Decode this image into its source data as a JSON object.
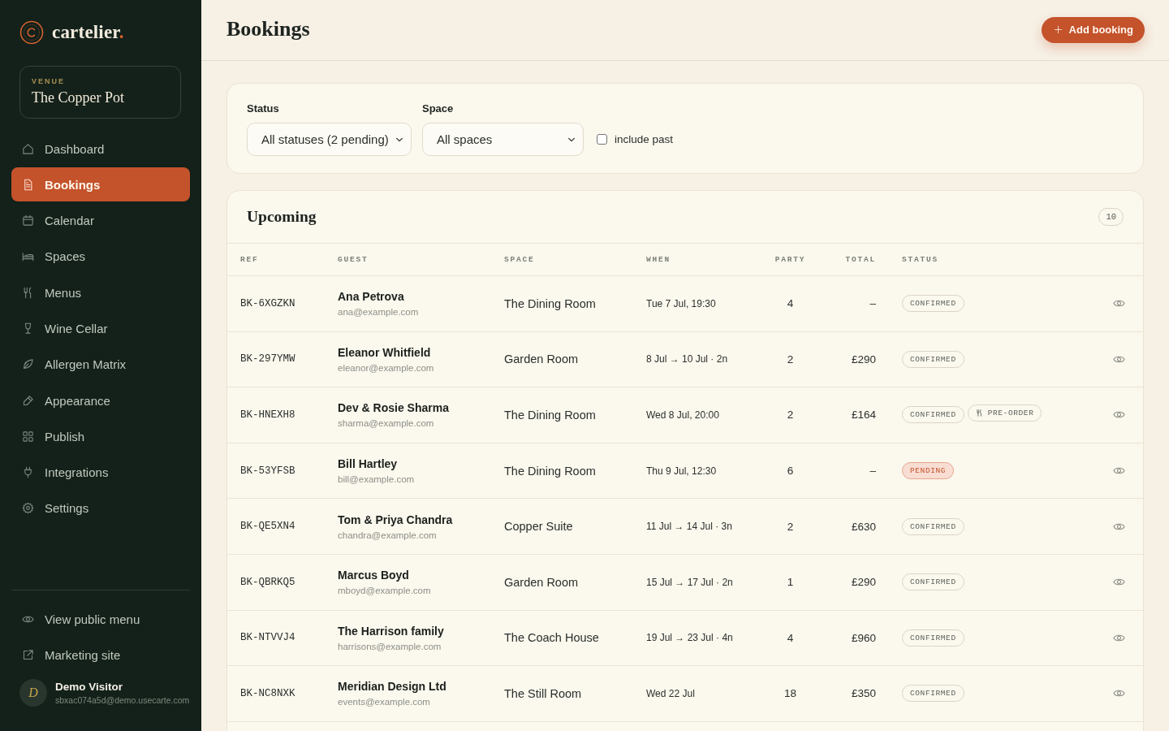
{
  "sidebar": {
    "brand": {
      "name": "cartelier",
      "accent": "."
    },
    "venue": {
      "label": "VENUE",
      "name": "The Copper Pot"
    },
    "nav": [
      {
        "label": "Dashboard",
        "selected": false
      },
      {
        "label": "Bookings",
        "selected": true
      },
      {
        "label": "Calendar",
        "selected": false
      },
      {
        "label": "Spaces",
        "selected": false
      },
      {
        "label": "Menus",
        "selected": false
      },
      {
        "label": "Wine Cellar",
        "selected": false
      },
      {
        "label": "Allergen Matrix",
        "selected": false
      },
      {
        "label": "Appearance",
        "selected": false
      },
      {
        "label": "Publish",
        "selected": false
      },
      {
        "label": "Integrations",
        "selected": false
      },
      {
        "label": "Settings",
        "selected": false
      }
    ],
    "footer_links": [
      {
        "label": "View public menu"
      },
      {
        "label": "Marketing site"
      }
    ],
    "user": {
      "initial": "D",
      "name": "Demo Visitor",
      "email": "sbxac074a5d@demo.usecarte.com"
    }
  },
  "header": {
    "title": "Bookings",
    "action": "Add booking"
  },
  "filters": {
    "status": {
      "label": "Status",
      "value": "All statuses (2 pending)"
    },
    "space": {
      "label": "Space",
      "value": "All spaces"
    },
    "include_past": {
      "label": "include past",
      "checked": false
    }
  },
  "upcoming": {
    "title": "Upcoming",
    "count": "10",
    "columns": [
      "REF",
      "GUEST",
      "SPACE",
      "WHEN",
      "PARTY",
      "TOTAL",
      "STATUS"
    ],
    "rows": [
      {
        "ref": "BK-6XGZKN",
        "guest": "Ana Petrova",
        "email": "ana@example.com",
        "space": "The Dining Room",
        "when": "Tue 7 Jul, 19:30",
        "party": "4",
        "total": "–",
        "status": {
          "label": "CONFIRMED",
          "kind": "confirmed"
        }
      },
      {
        "ref": "BK-297YMW",
        "guest": "Eleanor Whitfield",
        "email": "eleanor@example.com",
        "space": "Garden Room",
        "when": "8 Jul → 10 Jul · 2n",
        "party": "2",
        "total": "£290",
        "status": {
          "label": "CONFIRMED",
          "kind": "confirmed"
        }
      },
      {
        "ref": "BK-HNEXH8",
        "guest": "Dev & Rosie Sharma",
        "email": "sharma@example.com",
        "space": "The Dining Room",
        "when": "Wed 8 Jul, 20:00",
        "party": "2",
        "total": "£164",
        "status": {
          "label": "CONFIRMED",
          "kind": "confirmed"
        },
        "tags": [
          {
            "label": "PRE-ORDER"
          }
        ]
      },
      {
        "ref": "BK-53YFSB",
        "guest": "Bill Hartley",
        "email": "bill@example.com",
        "space": "The Dining Room",
        "when": "Thu 9 Jul, 12:30",
        "party": "6",
        "total": "–",
        "status": {
          "label": "PENDING",
          "kind": "pending"
        }
      },
      {
        "ref": "BK-QE5XN4",
        "guest": "Tom & Priya Chandra",
        "email": "chandra@example.com",
        "space": "Copper Suite",
        "when": "11 Jul → 14 Jul · 3n",
        "party": "2",
        "total": "£630",
        "status": {
          "label": "CONFIRMED",
          "kind": "confirmed"
        }
      },
      {
        "ref": "BK-QBRKQ5",
        "guest": "Marcus Boyd",
        "email": "mboyd@example.com",
        "space": "Garden Room",
        "when": "15 Jul → 17 Jul · 2n",
        "party": "1",
        "total": "£290",
        "status": {
          "label": "CONFIRMED",
          "kind": "confirmed"
        }
      },
      {
        "ref": "BK-NTVVJ4",
        "guest": "The Harrison family",
        "email": "harrisons@example.com",
        "space": "The Coach House",
        "when": "19 Jul → 23 Jul · 4n",
        "party": "4",
        "total": "£960",
        "status": {
          "label": "CONFIRMED",
          "kind": "confirmed"
        }
      },
      {
        "ref": "BK-NC8NXK",
        "guest": "Meridian Design Ltd",
        "email": "events@example.com",
        "space": "The Still Room",
        "when": "Wed 22 Jul",
        "party": "18",
        "total": "£350",
        "status": {
          "label": "CONFIRMED",
          "kind": "confirmed"
        }
      }
    ]
  }
}
